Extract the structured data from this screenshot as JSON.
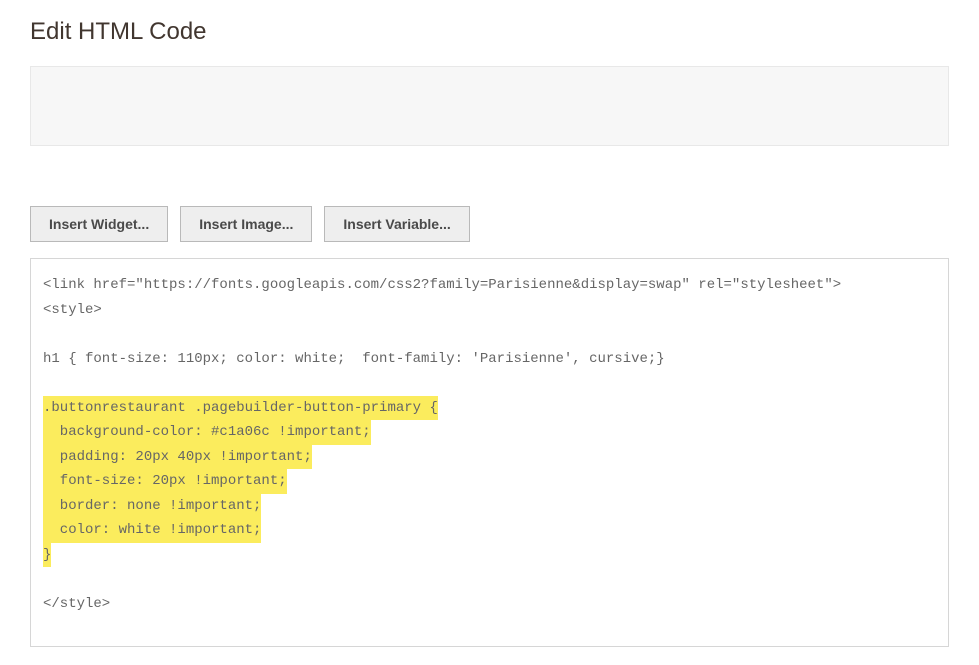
{
  "title": "Edit HTML Code",
  "toolbar": {
    "insertWidget": "Insert Widget...",
    "insertImage": "Insert Image...",
    "insertVariable": "Insert Variable..."
  },
  "code": {
    "line1": "<link href=\"https://fonts.googleapis.com/css2?family=Parisienne&display=swap\" rel=\"stylesheet\">",
    "line2": "<style>",
    "line3_blank": "",
    "line4": "h1 { font-size: 110px; color: white;  font-family: 'Parisienne', cursive;}",
    "line5_blank": "",
    "hl1": ".buttonrestaurant .pagebuilder-button-primary {",
    "hl2": "  background-color: #c1a06c !important;",
    "hl3": "  padding: 20px 40px !important;",
    "hl4": "  font-size: 20px !important;",
    "hl5": "  border: none !important;",
    "hl6": "  color: white !important;",
    "hl7": "}",
    "line_after_blank": "",
    "line_close": "</style>"
  }
}
